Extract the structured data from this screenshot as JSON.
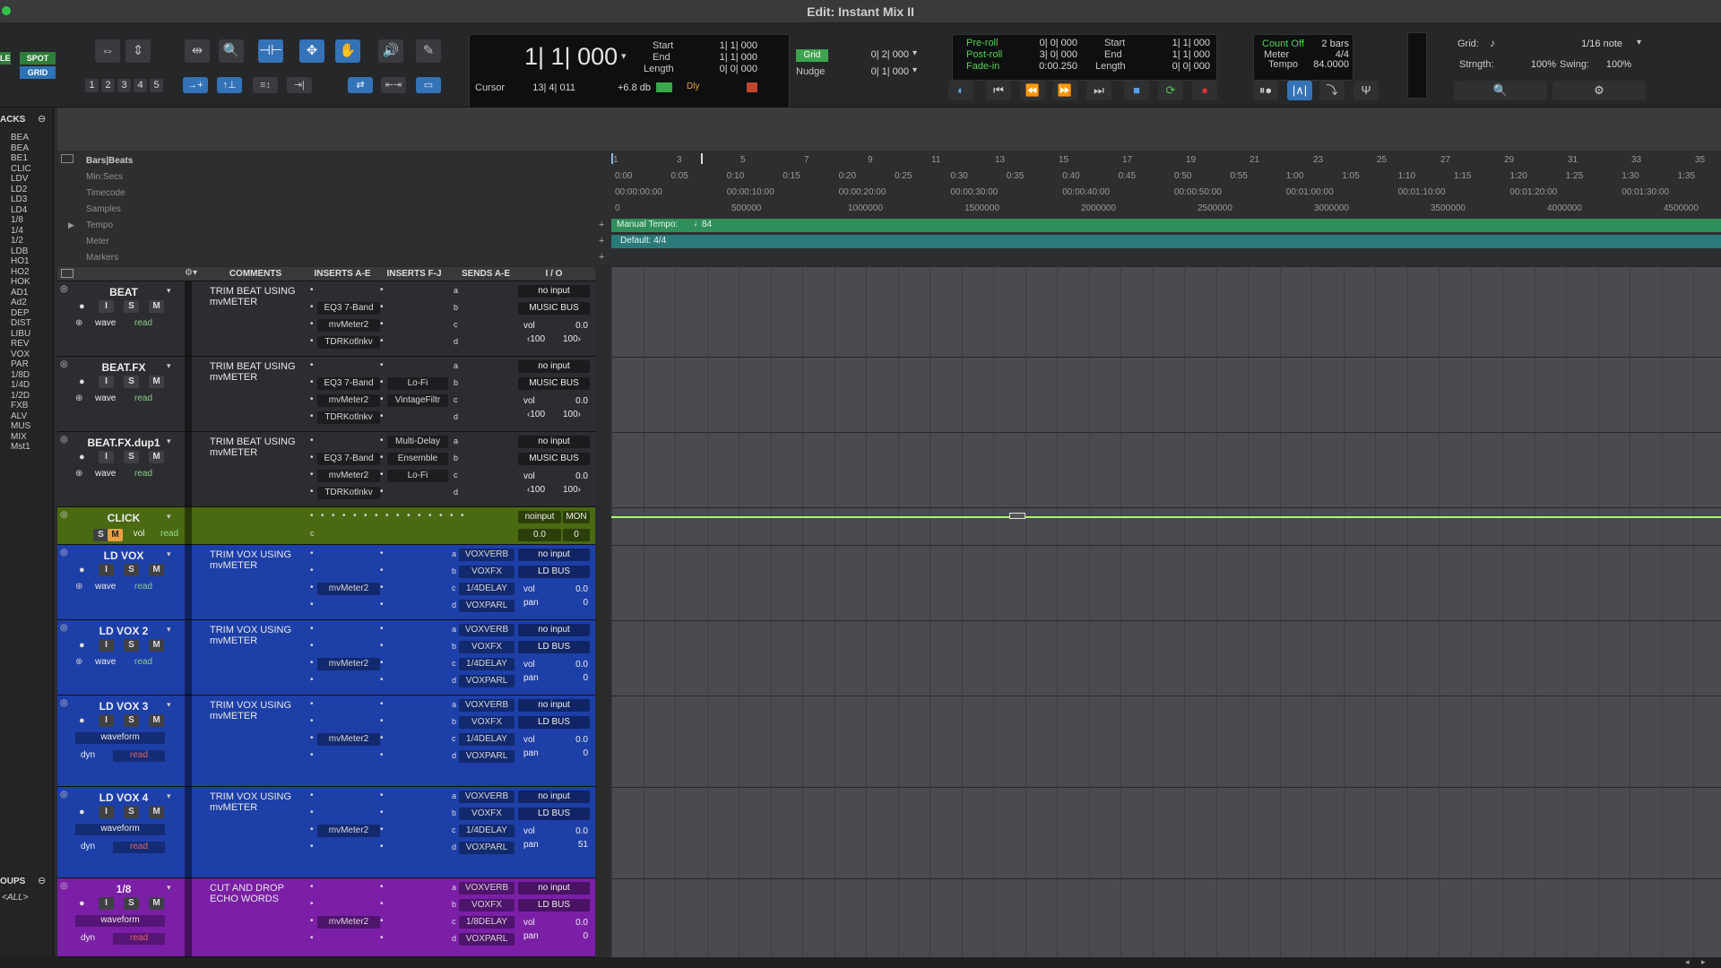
{
  "window": {
    "title": "Edit: Instant Mix II"
  },
  "toolbar": {
    "mode_buttons": [
      "LE",
      "SPOT",
      "GRID"
    ],
    "track_numbers": [
      "1",
      "2",
      "3",
      "4",
      "5"
    ],
    "main_counter": "1| 1| 000",
    "cursor_label": "Cursor",
    "cursor_value": "13| 4| 011",
    "level_readout": "+6.8 db",
    "dly_label": "Dly",
    "sel_labels": {
      "start": "Start",
      "end": "End",
      "length": "Length"
    },
    "sel_values": {
      "start": "1| 1| 000",
      "end": "1| 1| 000",
      "length": "0| 0| 000"
    },
    "grid_label": "Grid",
    "grid_value": "0| 2| 000",
    "nudge_label": "Nudge",
    "nudge_value": "0| 1| 000",
    "preroll_labels": {
      "pre": "Pre-roll",
      "post": "Post-roll",
      "fade": "Fade-in"
    },
    "preroll_values": {
      "pre": "0| 0| 000",
      "post": "3| 0| 000",
      "fade": "0:00.250"
    },
    "sel2_labels": {
      "start": "Start",
      "end": "End",
      "length": "Length"
    },
    "sel2_values": {
      "start": "1| 1| 000",
      "end": "1| 1| 000",
      "length": "0| 0| 000"
    },
    "count_off": "Count Off",
    "count_bars": "2 bars",
    "meter_label": "Meter",
    "meter_value": "4/4",
    "tempo_label": "Tempo",
    "tempo_value": "84.0000",
    "grid_right_label": "Grid:",
    "grid_right_value": "1/16 note",
    "strength_label": "Strngth:",
    "strength_value": "100%",
    "swing_label": "Swing:",
    "swing_value": "100%"
  },
  "left_panel": {
    "tracks_header": "ACKS",
    "tracks": [
      "BEA",
      "BEA",
      "BE1",
      "CLIC",
      "LDV",
      "LD2",
      "LD3",
      "LD4",
      "1/8",
      "1/4",
      "1/2",
      "LDB",
      "HO1",
      "HO2",
      "HOK",
      "AD1",
      "Ad2",
      "DEP",
      "DIST",
      "LIBU",
      "REV",
      "VOX",
      "PAR",
      "1/8D",
      "1/4D",
      "1/2D",
      "FXB",
      "ALV",
      "MUS",
      "MIX",
      "Mst1"
    ],
    "groups_header": "OUPS",
    "groups_all": "<ALL>"
  },
  "rulers": {
    "labels": [
      "Bars|Beats",
      "Min:Secs",
      "Timecode",
      "Samples",
      "Tempo",
      "Meter",
      "Markers"
    ],
    "bars": [
      "1",
      "3",
      "5",
      "7",
      "9",
      "11",
      "13",
      "15",
      "17",
      "19",
      "21",
      "23",
      "25",
      "27",
      "29",
      "31",
      "33",
      "35"
    ],
    "minsecs": [
      "0:00",
      "0:05",
      "0:10",
      "0:15",
      "0:20",
      "0:25",
      "0:30",
      "0:35",
      "0:40",
      "0:45",
      "0:50",
      "0:55",
      "1:00",
      "1:05",
      "1:10",
      "1:15",
      "1:20",
      "1:25",
      "1:30",
      "1:35"
    ],
    "timecode": [
      "00:00:00:00",
      "00:00:10:00",
      "00:00:20:00",
      "00:00:30:00",
      "00:00:40:00",
      "00:00:50:00",
      "00:01:00:00",
      "00:01:10:00",
      "00:01:20:00",
      "00:01:30:00"
    ],
    "samples": [
      "0",
      "500000",
      "1000000",
      "1500000",
      "2000000",
      "2500000",
      "3000000",
      "3500000",
      "4000000",
      "4500000"
    ],
    "tempo_text": "Manual Tempo:",
    "tempo_value": "84",
    "meter_text": "Default: 4/4"
  },
  "columns": [
    "COMMENTS",
    "INSERTS A-E",
    "INSERTS F-J",
    "SENDS A-E",
    "I / O"
  ],
  "tracks": [
    {
      "name": "BEAT",
      "comment": "TRIM BEAT USING mvMETER",
      "inserts_ae": [
        "",
        "EQ3 7-Band",
        "mvMeter2",
        "TDRKotlnkv"
      ],
      "inserts_fj": [
        "",
        "",
        "",
        ""
      ],
      "sends": [
        "a",
        "b",
        "c",
        "d"
      ],
      "input": "no input",
      "output": "MUSIC BUS",
      "vol": "0.0",
      "pan_l": "‹100",
      "pan_r": "100›",
      "view": "wave",
      "auto": "read"
    },
    {
      "name": "BEAT.FX",
      "comment": "TRIM BEAT USING mvMETER",
      "inserts_ae": [
        "",
        "EQ3 7-Band",
        "mvMeter2",
        "TDRKotlnkv"
      ],
      "inserts_fj": [
        "",
        "Lo-Fi",
        "VintageFiltr",
        ""
      ],
      "sends": [
        "a",
        "b",
        "c",
        "d"
      ],
      "input": "no input",
      "output": "MUSIC BUS",
      "vol": "0.0",
      "pan_l": "‹100",
      "pan_r": "100›",
      "view": "wave",
      "auto": "read"
    },
    {
      "name": "BEAT.FX.dup1",
      "comment": "TRIM BEAT USING mvMETER",
      "inserts_ae": [
        "",
        "EQ3 7-Band",
        "mvMeter2",
        "TDRKotlnkv"
      ],
      "inserts_fj": [
        "Multi-Delay",
        "Ensemble",
        "Lo-Fi",
        ""
      ],
      "sends": [
        "a",
        "b",
        "c",
        "d"
      ],
      "input": "no input",
      "output": "MUSIC BUS",
      "vol": "0.0",
      "pan_l": "‹100",
      "pan_r": "100›",
      "view": "wave",
      "auto": "read"
    },
    {
      "name": "CLICK",
      "input": "noinput",
      "mon": "MON",
      "vol": "0.0",
      "pan": "0",
      "auto": "read",
      "view": "vol"
    },
    {
      "name": "LD VOX",
      "comment": "TRIM VOX USING mvMETER",
      "inserts_ae": [
        "",
        "",
        "mvMeter2",
        ""
      ],
      "sends_named": [
        "VOXVERB",
        "VOXFX",
        "1/4DELAY",
        "VOXPARL"
      ],
      "input": "no input",
      "output": "LD BUS",
      "vol": "0.0",
      "pan": "0",
      "view": "wave",
      "auto": "read"
    },
    {
      "name": "LD VOX 2",
      "comment": "TRIM VOX USING mvMETER",
      "inserts_ae": [
        "",
        "",
        "mvMeter2",
        ""
      ],
      "sends_named": [
        "VOXVERB",
        "VOXFX",
        "1/4DELAY",
        "VOXPARL"
      ],
      "input": "no input",
      "output": "LD BUS",
      "vol": "0.0",
      "pan": "0",
      "view": "wave",
      "auto": "read"
    },
    {
      "name": "LD VOX 3",
      "comment": "TRIM VOX USING mvMETER",
      "inserts_ae": [
        "",
        "",
        "mvMeter2",
        ""
      ],
      "sends_named": [
        "VOXVERB",
        "VOXFX",
        "1/4DELAY",
        "VOXPARL"
      ],
      "input": "no input",
      "output": "LD BUS",
      "vol": "0.0",
      "pan": "0",
      "view": "waveform",
      "auto": "read",
      "dyn": "dyn"
    },
    {
      "name": "LD VOX 4",
      "comment": "TRIM VOX USING mvMETER",
      "inserts_ae": [
        "",
        "",
        "mvMeter2",
        ""
      ],
      "sends_named": [
        "VOXVERB",
        "VOXFX",
        "1/4DELAY",
        "VOXPARL"
      ],
      "input": "no input",
      "output": "LD BUS",
      "vol": "0.0",
      "pan": "51",
      "view": "waveform",
      "auto": "read",
      "dyn": "dyn"
    },
    {
      "name": "1/8",
      "comment": "CUT AND DROP ECHO WORDS",
      "inserts_ae": [
        "",
        "",
        "mvMeter2",
        ""
      ],
      "sends_named": [
        "VOXVERB",
        "VOXFX",
        "1/8DELAY",
        "VOXPARL"
      ],
      "input": "no input",
      "output": "LD BUS",
      "vol": "0.0",
      "pan": "0",
      "view": "waveform",
      "auto": "read",
      "dyn": "dyn"
    }
  ],
  "colors": {
    "accent": "#3473b8",
    "beat_track": "#2c2d30",
    "click_track": "#4a6a12",
    "vox_track": "#1d3fa8",
    "eighth_track": "#7a1fa6",
    "tempo_strip": "#2f8f5a",
    "meter_strip": "#2a7a7a",
    "record": "#e03030"
  }
}
